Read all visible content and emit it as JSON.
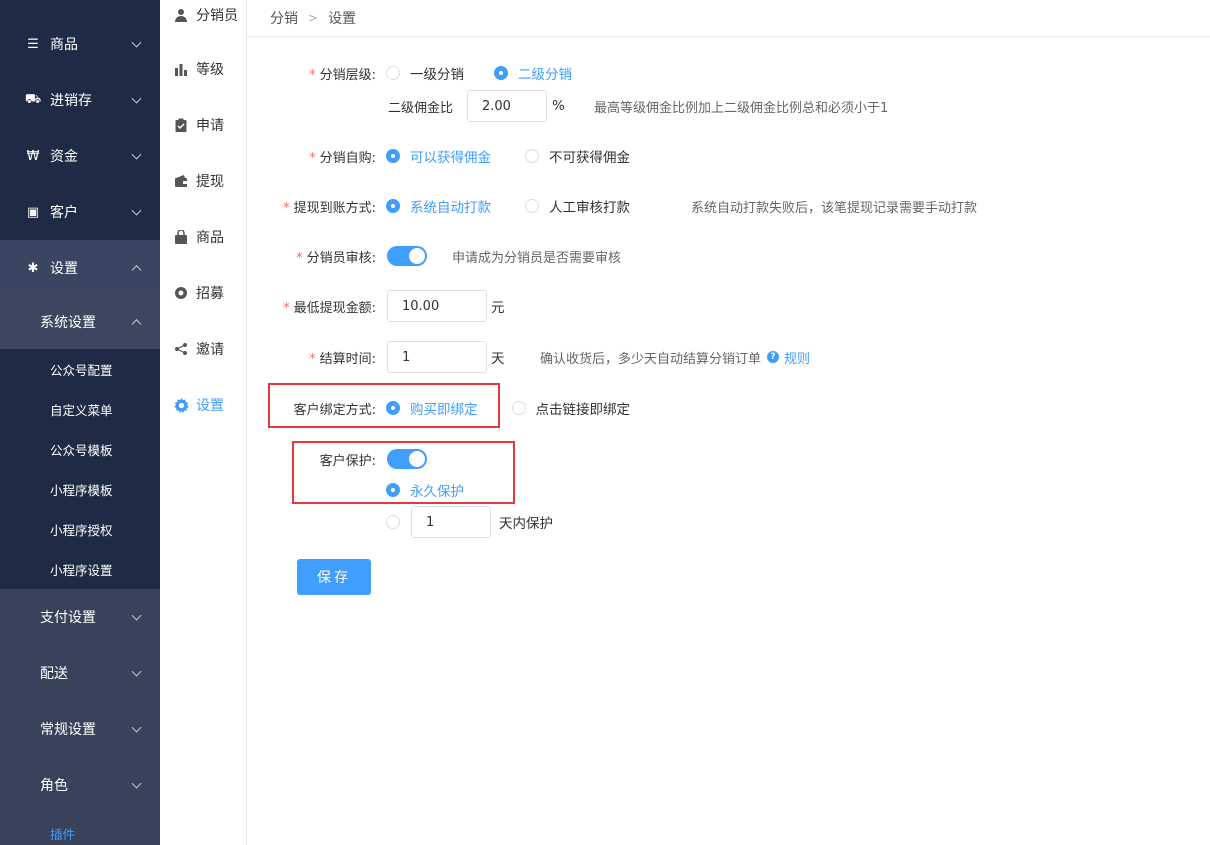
{
  "sidebar": {
    "top": [
      {
        "label": "商品",
        "icon": "list-icon"
      },
      {
        "label": "进销存",
        "icon": "truck-icon"
      },
      {
        "label": "资金",
        "icon": "won-icon"
      },
      {
        "label": "客户",
        "icon": "id-card-icon"
      },
      {
        "label": "设置",
        "icon": "gear-icon"
      }
    ],
    "system_settings": "系统设置",
    "leaves": [
      "公众号配置",
      "自定义菜单",
      "公众号模板",
      "小程序模板",
      "小程序授权",
      "小程序设置"
    ],
    "lower": [
      "支付设置",
      "配送",
      "常规设置",
      "角色"
    ],
    "plugin": "插件"
  },
  "subnav": [
    {
      "label": "分销员",
      "icon": "user-icon"
    },
    {
      "label": "等级",
      "icon": "bar-chart-icon"
    },
    {
      "label": "申请",
      "icon": "clipboard-icon"
    },
    {
      "label": "提现",
      "icon": "wallet-icon"
    },
    {
      "label": "商品",
      "icon": "bag-icon"
    },
    {
      "label": "招募",
      "icon": "lifebuoy-icon"
    },
    {
      "label": "邀请",
      "icon": "share-icon"
    },
    {
      "label": "设置",
      "icon": "gear-icon"
    }
  ],
  "breadcrumb": {
    "parent": "分销",
    "current": "设置"
  },
  "form": {
    "level": {
      "label": "分销层级:",
      "opt1": "一级分销",
      "opt2": "二级分销"
    },
    "commission": {
      "label": "二级佣金比",
      "value": "2.00",
      "unit": "%",
      "hint": "最高等级佣金比例加上二级佣金比例总和必须小于1"
    },
    "self_buy": {
      "label": "分销自购:",
      "opt1": "可以获得佣金",
      "opt2": "不可获得佣金"
    },
    "withdraw": {
      "label": "提现到账方式:",
      "opt1": "系统自动打款",
      "opt2": "人工审核打款",
      "hint": "系统自动打款失败后，该笔提现记录需要手动打款"
    },
    "review": {
      "label": "分销员审核:",
      "hint": "申请成为分销员是否需要审核"
    },
    "min_withdraw": {
      "label": "最低提现金额:",
      "value": "10.00",
      "unit": "元"
    },
    "settle": {
      "label": "结算时间:",
      "value": "1",
      "unit": "天",
      "hint": "确认收货后，多少天自动结算分销订单",
      "link": "规则"
    },
    "bind": {
      "label": "客户绑定方式:",
      "opt1": "购买即绑定",
      "opt2": "点击链接即绑定"
    },
    "protect": {
      "label": "客户保护:",
      "opt1": "永久保护",
      "days": "1",
      "days_unit": "天内保护"
    },
    "save": "保存"
  }
}
